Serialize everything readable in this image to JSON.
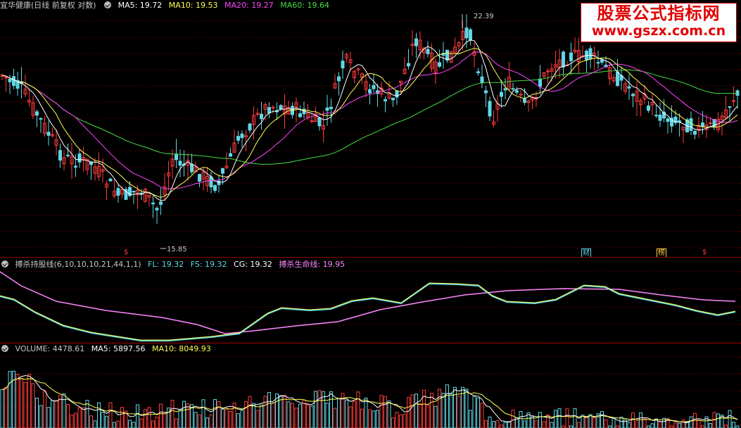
{
  "colors": {
    "up": "#ff3b3b",
    "down": "#5fd7e6",
    "ma5": "#ffffff",
    "ma10": "#ffff54",
    "ma20": "#ff44ff",
    "ma60": "#44dd44",
    "fl_fs": "#5fd7e6",
    "cg": "#ffffff",
    "life_line": "#ff88ff",
    "grid": "#8a0000",
    "label": "#c8c8c8"
  },
  "price_panel": {
    "stock_title": "宜华健康(日线 前复权 对数)",
    "ma5_label": "MA5: 19.72",
    "ma10_label": "MA10: 19.53",
    "ma20_label": "MA20: 19.27",
    "ma60_label": "MA60: 19.64",
    "high_label": "22.39",
    "low_label": "15.85",
    "event_marks": [
      {
        "text": "$",
        "color": "#ff3b3b"
      },
      {
        "text": "财",
        "color": "#5fd7e6"
      },
      {
        "text": "榜",
        "color": "#ffcc44"
      },
      {
        "text": "$",
        "color": "#ff3b3b"
      }
    ]
  },
  "indicator_panel": {
    "name_label": "搏杀持股线(6,10,10,10,21,44,1,1)",
    "fl_label": "FL: 19.32",
    "fs_label": "FS: 19.32",
    "cg_label": "CG: 19.32",
    "life_label": "搏杀生命线: 19.95"
  },
  "volume_panel": {
    "volume_label": "VOLUME: 4478.61",
    "ma5_label": "MA5: 5897.56",
    "ma10_label": "MA10: 8049.93"
  },
  "watermark": {
    "title": "股票公式指标网",
    "url": "www.gszx.com.cn"
  }
}
